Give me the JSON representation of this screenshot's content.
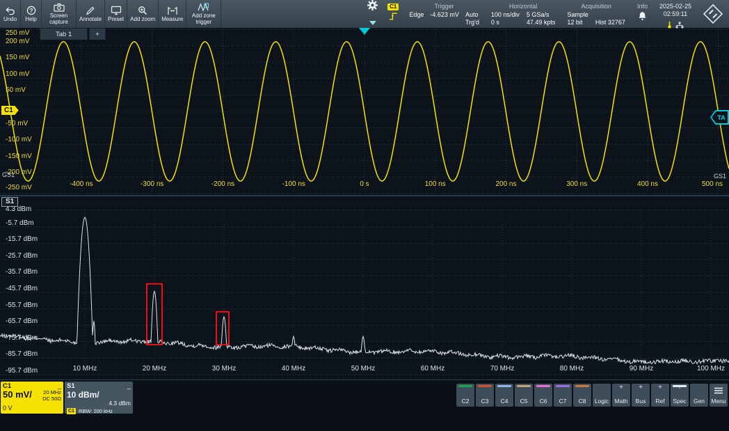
{
  "colors": {
    "accent_yellow": "#f6e200",
    "accent_cyan": "#00c9da",
    "zone_red": "#ff1414",
    "trace_white": "#dde3e6",
    "grid": "#2e4254"
  },
  "toolbar": {
    "buttons": [
      {
        "label": "Undo",
        "icon": "undo-icon"
      },
      {
        "label": "Help",
        "icon": "help-icon"
      },
      {
        "label": "Screen capture",
        "icon": "camera-icon"
      },
      {
        "label": "Annotate",
        "icon": "pencil-icon"
      },
      {
        "label": "Preset",
        "icon": "preset-icon"
      },
      {
        "label": "Add zoom",
        "icon": "add-zoom-icon"
      },
      {
        "label": "Measure",
        "icon": "measure-icon"
      },
      {
        "label": "Add zone trigger",
        "icon": "zone-trigger-icon"
      }
    ],
    "trigger_source_channel": "C1",
    "trigger": {
      "title": "Trigger",
      "type": "Edge",
      "level": "-4.623 mV",
      "mode": "Auto",
      "state": "Trg'd"
    },
    "horizontal": {
      "title": "Horizontal",
      "scale": "100 ns/div",
      "rate": "5 GSa/s",
      "position": "0 s",
      "points": "47.49 kpts"
    },
    "acquisition": {
      "title": "Acquisition",
      "mode": "Sample",
      "bits": "12 bit",
      "history": "Hist 32767"
    },
    "info_title": "Info",
    "date": "2025-02-25",
    "time": "02:59:11"
  },
  "tabs": {
    "active": "Tab 1",
    "add": "+"
  },
  "waveform": {
    "channel_badge": "C1",
    "trigger_marker_label": "TA",
    "grid_label": "GS1"
  },
  "spectrum": {
    "badge": "S1"
  },
  "bottom_bar": {
    "c1_badge": {
      "name": "C1",
      "minimize": "_",
      "scale": "50 mV/",
      "bandwidth": "20 MHz",
      "coupling": "DC 50Ω",
      "offset": "0 V"
    },
    "s1_badge": {
      "name": "S1",
      "minimize": "_",
      "scale": "10 dBm/",
      "ref": "4.3 dBm",
      "source": "C1",
      "rbw": "RBW: 200 kHz"
    },
    "channels": [
      {
        "label": "C2",
        "stripe": "#18a84c"
      },
      {
        "label": "C3",
        "stripe": "#d4512b"
      },
      {
        "label": "C4",
        "stripe": "#8fb4f0"
      },
      {
        "label": "C5",
        "stripe": "#c3a378"
      },
      {
        "label": "C6",
        "stripe": "#e86fd0"
      },
      {
        "label": "C7",
        "stripe": "#9b6fe8"
      },
      {
        "label": "C8",
        "stripe": "#cd7a35"
      },
      {
        "label": "Logic"
      },
      {
        "label": "Math",
        "plus": "+"
      },
      {
        "label": "Bus",
        "plus": "+"
      },
      {
        "label": "Ref",
        "plus": "+"
      },
      {
        "label": "Spec",
        "plus": "+",
        "stripe": "#e8ecee"
      },
      {
        "label": "Gen"
      },
      {
        "label": "Menu",
        "icon": "menu-icon"
      }
    ]
  },
  "chart_data": [
    {
      "type": "line",
      "name": "C1 time-domain waveform",
      "signal": "sine",
      "x_unit": "ns",
      "y_unit": "mV",
      "frequency_mhz": 10,
      "amplitude_mv": 212,
      "offset_mv": 0,
      "phase_deg": 181.25,
      "x_range_ns": [
        -515,
        515
      ],
      "y_range_mv": [
        -250,
        250
      ],
      "x_ticks": [
        "-400 ns",
        "-300 ns",
        "-200 ns",
        "-100 ns",
        "0 s",
        "100 ns",
        "200 ns",
        "300 ns",
        "400 ns",
        "500 ns"
      ],
      "x_tick_values_ns": [
        -400,
        -300,
        -200,
        -100,
        0,
        100,
        200,
        300,
        400,
        500
      ],
      "y_ticks": [
        "250 mV",
        "200 mV",
        "150 mV",
        "100 mV",
        "50 mV",
        "-50 mV",
        "-100 mV",
        "-150 mV",
        "-200 mV",
        "-250 mV"
      ],
      "y_tick_values_mv": [
        250,
        200,
        150,
        100,
        50,
        -50,
        -100,
        -150,
        -200,
        -250
      ],
      "grid": true,
      "color": "#f6e200"
    },
    {
      "type": "line",
      "name": "S1 FFT spectrum",
      "x_unit": "MHz",
      "y_unit": "dBm",
      "x_range_mhz": [
        -2.2,
        102.6
      ],
      "y_top_dbm": 4.3,
      "y_bottom_dbm": -95.7,
      "noise_floor_dbm": {
        "at_0_mhz": -73.5,
        "at_100_mhz": -88.5
      },
      "peaks": [
        {
          "f_mhz": 10,
          "level_dbm": 0,
          "width": 0.45
        },
        {
          "f_mhz": 11.3,
          "level_dbm": -63,
          "width": 0.18
        },
        {
          "f_mhz": 20,
          "level_dbm": -45,
          "width": 0.3
        },
        {
          "f_mhz": 30,
          "level_dbm": -60.5,
          "width": 0.3
        },
        {
          "f_mhz": 40,
          "level_dbm": -72.5,
          "width": 0.3
        },
        {
          "f_mhz": 50,
          "level_dbm": -72.5,
          "width": 0.3
        }
      ],
      "zones": [
        {
          "f1_mhz": 18.9,
          "f2_mhz": 21.1,
          "top_dbm": -40.5,
          "bottom_dbm": -77.5
        },
        {
          "f1_mhz": 28.9,
          "f2_mhz": 30.7,
          "top_dbm": -57.5,
          "bottom_dbm": -77.5
        }
      ],
      "x_ticks": [
        "10 MHz",
        "20 MHz",
        "30 MHz",
        "40 MHz",
        "50 MHz",
        "60 MHz",
        "70 MHz",
        "80 MHz",
        "90 MHz",
        "100 MHz"
      ],
      "x_tick_values_mhz": [
        10,
        20,
        30,
        40,
        50,
        60,
        70,
        80,
        90,
        100
      ],
      "y_ticks": [
        "4.3 dBm",
        "-5.7 dBm",
        "-15.7 dBm",
        "-25.7 dBm",
        "-35.7 dBm",
        "-45.7 dBm",
        "-55.7 dBm",
        "-65.7 dBm",
        "-75.7 dBm",
        "-85.7 dBm",
        "-95.7 dBm"
      ],
      "y_tick_values_dbm": [
        4.3,
        -5.7,
        -15.7,
        -25.7,
        -35.7,
        -45.7,
        -55.7,
        -65.7,
        -75.7,
        -85.7,
        -95.7
      ],
      "grid": true,
      "color": "#dde3e6"
    }
  ]
}
